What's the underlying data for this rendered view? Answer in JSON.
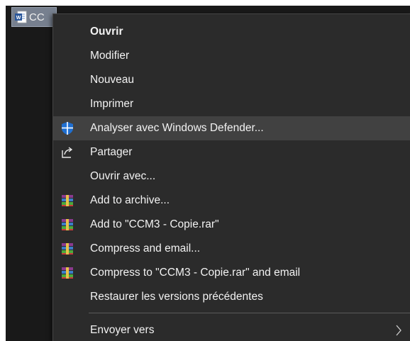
{
  "file": {
    "name_partial": "CC",
    "icon": "word-document-icon"
  },
  "menu": {
    "items": [
      {
        "label": "Ouvrir",
        "bold": true,
        "icon": null
      },
      {
        "label": "Modifier",
        "icon": null
      },
      {
        "label": "Nouveau",
        "icon": null
      },
      {
        "label": "Imprimer",
        "icon": null
      },
      {
        "label": "Analyser avec Windows Defender...",
        "icon": "windows-defender-shield-icon",
        "highlighted": true
      },
      {
        "label": "Partager",
        "icon": "share-icon"
      },
      {
        "label": "Ouvrir avec...",
        "icon": null
      },
      {
        "label": "Add to archive...",
        "icon": "winrar-icon"
      },
      {
        "label": "Add to \"CCM3 - Copie.rar\"",
        "icon": "winrar-icon"
      },
      {
        "label": "Compress and email...",
        "icon": "winrar-icon"
      },
      {
        "label": "Compress to \"CCM3 - Copie.rar\" and email",
        "icon": "winrar-icon"
      },
      {
        "label": "Restaurer les versions précédentes",
        "icon": null
      },
      {
        "label": "Envoyer vers",
        "icon": null,
        "submenu": true
      }
    ]
  },
  "colors": {
    "menu_bg": "#2b2b2b",
    "highlight_bg": "#414141",
    "text": "#f2f2f2",
    "defender_blue": "#1f6fd1",
    "explorer_bg": "#191919",
    "file_selected_bg": "#77808f"
  }
}
